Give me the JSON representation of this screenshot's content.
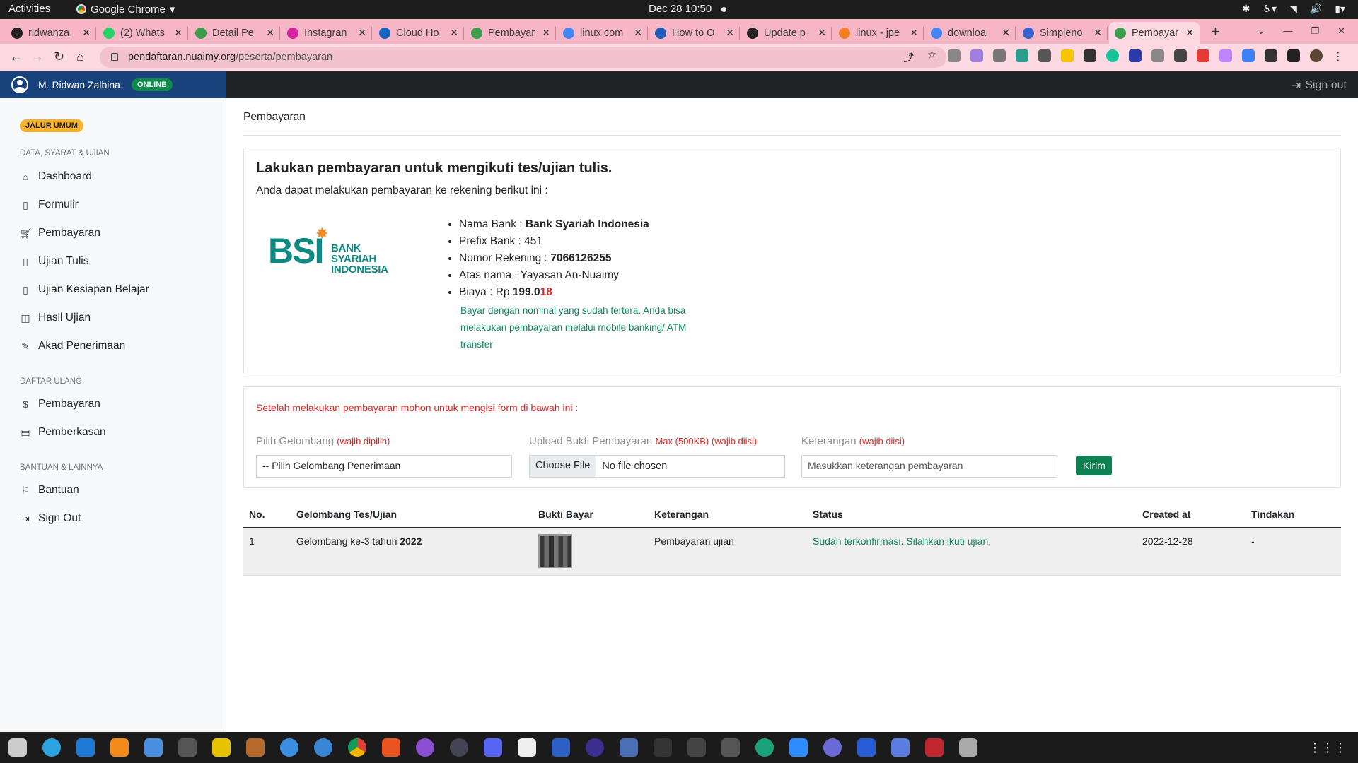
{
  "system": {
    "activities": "Activities",
    "app_name": "Google Chrome",
    "clock": "Dec 28  10:50"
  },
  "browser": {
    "tabs": [
      {
        "title": "ridwanza",
        "favicon": "github-icon",
        "color": "#222"
      },
      {
        "title": "(2) Whats",
        "favicon": "whatsapp-icon",
        "color": "#25d366"
      },
      {
        "title": "Detail Pe",
        "favicon": "site-icon",
        "color": "#3b9c4b"
      },
      {
        "title": "Instagran",
        "favicon": "instagram-icon",
        "color": "#d6249f"
      },
      {
        "title": "Cloud Ho",
        "favicon": "cloud-icon",
        "color": "#1565c0"
      },
      {
        "title": "Pembayar",
        "favicon": "site-icon",
        "color": "#3b9c4b"
      },
      {
        "title": "linux com",
        "favicon": "google-icon",
        "color": "#4285f4"
      },
      {
        "title": "How to O",
        "favicon": "info-icon",
        "color": "#1e5bb8"
      },
      {
        "title": "Update p",
        "favicon": "github-icon",
        "color": "#222"
      },
      {
        "title": "linux - jpe",
        "favicon": "stackoverflow-icon",
        "color": "#f48024"
      },
      {
        "title": "downloa",
        "favicon": "google-icon",
        "color": "#4285f4"
      },
      {
        "title": "Simpleno",
        "favicon": "simplenote-icon",
        "color": "#3361cc"
      },
      {
        "title": "Pembayar",
        "favicon": "site-icon",
        "color": "#3b9c4b"
      }
    ],
    "active_tab": 12,
    "url_domain": "pendaftaran.nuaimy.org",
    "url_path": "/peserta/pembayaran"
  },
  "header": {
    "user_name": "M. Ridwan Zalbina",
    "status_badge": "ONLINE",
    "signout": "Sign out"
  },
  "sidebar": {
    "badge": "JALUR UMUM",
    "sections": [
      {
        "heading": "DATA, SYARAT & UJIAN"
      },
      {
        "heading": "DAFTAR ULANG"
      },
      {
        "heading": "BANTUAN & LAINNYA"
      }
    ],
    "items": [
      {
        "label": "Dashboard",
        "icon": "home-icon"
      },
      {
        "label": "Formulir",
        "icon": "clipboard-icon"
      },
      {
        "label": "Pembayaran",
        "icon": "cart-icon"
      },
      {
        "label": "Ujian Tulis",
        "icon": "file-icon"
      },
      {
        "label": "Ujian Kesiapan Belajar",
        "icon": "file-icon"
      },
      {
        "label": "Hasil Ujian",
        "icon": "book-icon"
      },
      {
        "label": "Akad Penerimaan",
        "icon": "pen-icon"
      },
      {
        "label": "Pembayaran",
        "icon": "dollar-icon"
      },
      {
        "label": "Pemberkasan",
        "icon": "archive-icon"
      },
      {
        "label": "Bantuan",
        "icon": "flag-icon"
      },
      {
        "label": "Sign Out",
        "icon": "logout-icon"
      }
    ]
  },
  "main": {
    "breadcrumb": "Pembayaran",
    "card": {
      "title": "Lakukan pembayaran untuk mengikuti tes/ujian tulis.",
      "subtitle": "Anda dapat melakukan pembayaran ke rekening berikut ini :",
      "logo": {
        "short": "BSI",
        "line1": "BANK SYARIAH",
        "line2": "INDONESIA"
      },
      "bank_label": "Nama Bank : ",
      "bank_value": "Bank Syariah Indonesia",
      "prefix": "Prefix Bank : 451",
      "rek_label": "Nomor Rekening : ",
      "rek_value": "7066126255",
      "atas_nama": "Atas nama : Yayasan An-Nuaimy",
      "biaya_label": "Biaya : Rp.",
      "biaya_main": "199.0",
      "biaya_red": "18",
      "note": "Bayar dengan nominal yang sudah tertera. Anda bisa melakukan pembayaran melalui mobile banking/ ATM transfer"
    },
    "form": {
      "lead": "Setelah melakukan pembayaran mohon untuk mengisi form di bawah ini :",
      "gelombang_label": "Pilih Gelombang",
      "gelombang_req": "(wajib dipilih)",
      "gelombang_value": "-- Pilih Gelombang Penerimaan",
      "upload_label": "Upload Bukti Pembayaran",
      "upload_req": "Max (500KB) (wajib diisi)",
      "file_button": "Choose File",
      "file_status": "No file chosen",
      "ket_label": "Keterangan",
      "ket_req": "(wajib diisi)",
      "ket_placeholder": "Masukkan keterangan pembayaran",
      "submit": "Kirim"
    },
    "table": {
      "headers": [
        "No.",
        "Gelombang Tes/Ujian",
        "Bukti Bayar",
        "Keterangan",
        "Status",
        "Created at",
        "Tindakan"
      ],
      "rows": [
        {
          "no": "1",
          "gelombang_prefix": "Gelombang ke-3 tahun ",
          "gelombang_year": "2022",
          "keterangan": "Pembayaran ujian",
          "status": "Sudah terkonfirmasi. Silahkan ikuti ujian.",
          "created_at": "2022-12-28",
          "tindakan": "-"
        }
      ]
    }
  }
}
